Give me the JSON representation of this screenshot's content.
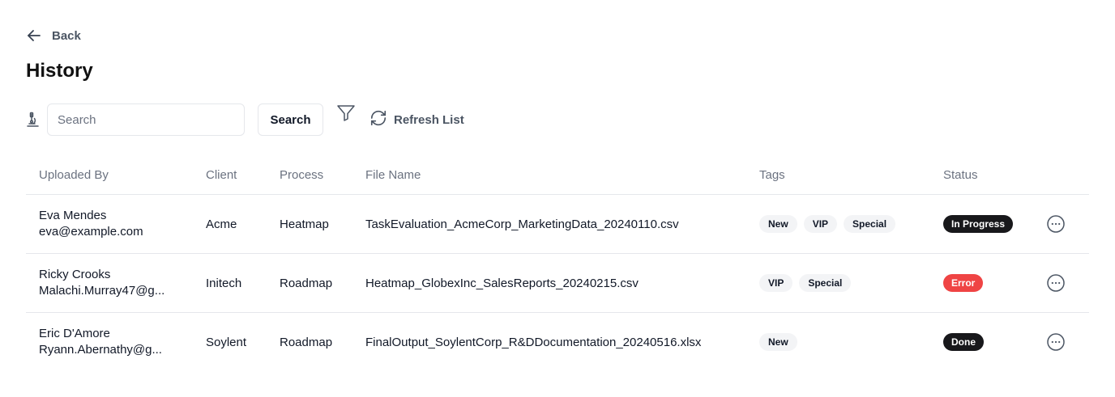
{
  "nav": {
    "back_label": "Back"
  },
  "page": {
    "title": "History"
  },
  "toolbar": {
    "search_placeholder": "Search",
    "search_value": "",
    "search_button_label": "Search",
    "refresh_label": "Refresh List",
    "icons": {
      "back": "arrow-left-icon",
      "search_lead": "microscope-icon",
      "filter": "filter-icon",
      "refresh": "refresh-icon",
      "row_actions": "more-horizontal-icon"
    }
  },
  "table": {
    "columns": [
      "Uploaded By",
      "Client",
      "Process",
      "File Name",
      "Tags",
      "Status"
    ],
    "rows": [
      {
        "name": "Eva Mendes",
        "email": "eva@example.com",
        "client": "Acme",
        "process": "Heatmap",
        "file": "TaskEvaluation_AcmeCorp_MarketingData_20240110.csv",
        "tags": [
          "New",
          "VIP",
          "Special"
        ],
        "status": "In Progress",
        "status_color": "#18181b"
      },
      {
        "name": "Ricky Crooks",
        "email": "Malachi.Murray47@g...",
        "client": "Initech",
        "process": "Roadmap",
        "file": "Heatmap_GlobexInc_SalesReports_20240215.csv",
        "tags": [
          "VIP",
          "Special"
        ],
        "status": "Error",
        "status_color": "#ef4444"
      },
      {
        "name": "Eric D'Amore",
        "email": "Ryann.Abernathy@g...",
        "client": "Soylent",
        "process": "Roadmap",
        "file": "FinalOutput_SoylentCorp_R&DDocumentation_20240516.xlsx",
        "tags": [
          "New"
        ],
        "status": "Done",
        "status_color": "#18181b"
      }
    ]
  },
  "colors": {
    "tag_bg": "#f3f4f6",
    "border": "#e5e7eb",
    "muted_text": "#6b7280"
  }
}
